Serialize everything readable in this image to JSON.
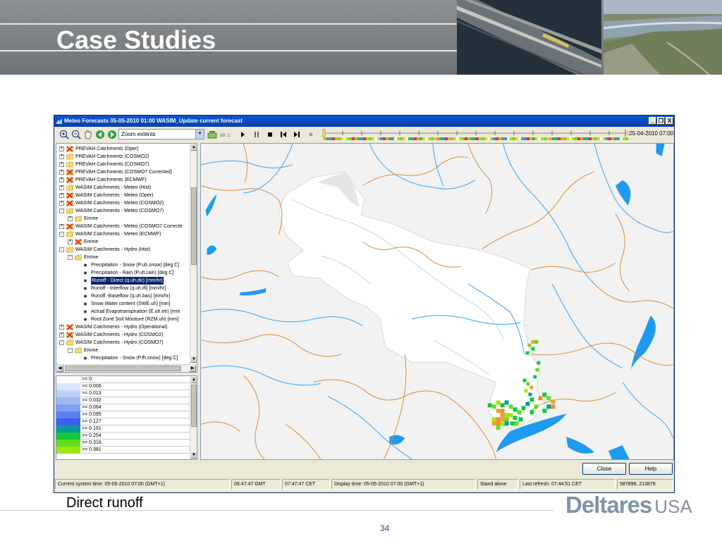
{
  "slide": {
    "title": "Case Studies",
    "caption": "Direct runoff",
    "page_number": "34",
    "brand_main": "Deltares",
    "brand_suffix": "USA"
  },
  "window": {
    "title": "Meteo Forecasts 05-05-2010 01:00 WASIM_Update current forecast",
    "minimize": "_",
    "restore": "❐",
    "close": "X"
  },
  "toolbar": {
    "zoom_value": "Zoom extents",
    "timeline_readout": "25-04-2010 07:00"
  },
  "tree": {
    "items": [
      {
        "label": "PREVAH Catchments (Oper)",
        "icon": "cross-icon",
        "expander": "+"
      },
      {
        "label": "PREVAH Catchments (COSMO2)",
        "icon": "folder-icon",
        "expander": "+"
      },
      {
        "label": "PREVAH Catchments (COSMO7)",
        "icon": "folder-icon",
        "expander": "+"
      },
      {
        "label": "PREVAH Catchments (COSMO7 Corrected)",
        "icon": "cross-icon",
        "expander": "+"
      },
      {
        "label": "PREVAH Catchments (ECMWF)",
        "icon": "cross-icon",
        "expander": "+"
      },
      {
        "label": "WASIM Catchments - Meteo (Hist)",
        "icon": "folder-icon",
        "expander": "+"
      },
      {
        "label": "WASIM Catchments - Meteo (Oper)",
        "icon": "cross-icon",
        "expander": "+"
      },
      {
        "label": "WASIM Catchments - Meteo (COSMO2)",
        "icon": "cross-icon",
        "expander": "+"
      },
      {
        "label": "WASIM Catchments - Meteo (COSMO7)",
        "icon": "folder-icon",
        "expander": "-"
      },
      {
        "label": "Emme",
        "icon": "folder-icon",
        "expander": "+"
      },
      {
        "label": "WASIM Catchments - Meteo (COSMO7 Correcte",
        "icon": "cross-icon",
        "expander": "+"
      },
      {
        "label": "WASIM Catchments - Meteo (ECMWF)",
        "icon": "folder-icon",
        "expander": "-"
      },
      {
        "label": "Emme",
        "icon": "cross-icon",
        "expander": "+"
      },
      {
        "label": "WASIM Catchments - Hydro (Hist)",
        "icon": "folder-icon",
        "expander": "-"
      },
      {
        "label": "Emme",
        "icon": "folder-icon",
        "expander": "-"
      },
      {
        "label": "Precipitation - Snow (P.uh.snow) [deg C]",
        "icon": "bullet-icon",
        "expander": ""
      },
      {
        "label": "Precipitation - Rain (P.uh.rain) [deg C]",
        "icon": "bullet-icon",
        "expander": ""
      },
      {
        "label": "Runoff - Direct (q.uh.dir) [mm/hr]",
        "icon": "bullet-icon",
        "expander": "",
        "selected": true
      },
      {
        "label": "Runoff - Interflow (q.uh.ifl) [mm/hr]",
        "icon": "bullet-icon",
        "expander": ""
      },
      {
        "label": "Runoff -Baseflow (q.uh.bas) [mm/hr]",
        "icon": "bullet-icon",
        "expander": ""
      },
      {
        "label": "Snow Water content (SWE.uh) [mm]",
        "icon": "bullet-icon",
        "expander": ""
      },
      {
        "label": "Actual Evapotranspiration (E.uh.etr) [mm",
        "icon": "bullet-icon",
        "expander": ""
      },
      {
        "label": "Root Zone Soil Moisture (RZM.uh) [mm]",
        "icon": "bullet-icon",
        "expander": ""
      },
      {
        "label": "WASIM Catchments - Hydro (Operational)",
        "icon": "cross-icon",
        "expander": "+"
      },
      {
        "label": "WASIM Catchments - Hydro (COSMO2)",
        "icon": "cross-icon",
        "expander": "+"
      },
      {
        "label": "WASIM Catchments - Hydro (COSMO7)",
        "icon": "folder-icon",
        "expander": "-"
      },
      {
        "label": "Emme",
        "icon": "folder-icon",
        "expander": "-"
      },
      {
        "label": "Precipitation - Snow (P.fh.snow) [deg C]",
        "icon": "bullet-icon",
        "expander": ""
      }
    ]
  },
  "legend": {
    "items": [
      {
        "label": ">= 0",
        "color": "#ffffff"
      },
      {
        "label": ">= 0.006",
        "color": "#dbe6fb"
      },
      {
        "label": ">= 0.013",
        "color": "#bfd1f7"
      },
      {
        "label": ">= 0.032",
        "color": "#a1b9f2"
      },
      {
        "label": ">= 0.064",
        "color": "#819fee"
      },
      {
        "label": ">= 0.095",
        "color": "#5c7ff0"
      },
      {
        "label": ">= 0.127",
        "color": "#3f5ef2"
      },
      {
        "label": ">= 0.191",
        "color": "#0a9a9a"
      },
      {
        "label": ">= 0.254",
        "color": "#14c83c"
      },
      {
        "label": ">= 0.318",
        "color": "#64dc1e"
      },
      {
        "label": ">= 0.381",
        "color": "#a0e614"
      }
    ]
  },
  "buttons": {
    "close": "Close",
    "help": "Help"
  },
  "status": {
    "system_time": "Current system time: 05-05-2010 07:00 (GMT+1)",
    "gmt": "06:47:47 GMT",
    "cet": "07:47:47 CET",
    "display_time": "Display time: 05-05-2010 07:00 (GMT+1)",
    "mode": "Stand alone",
    "last_refresh": "Last refresh: 07:44:51 CET",
    "coordinates": "587898, 213878"
  }
}
